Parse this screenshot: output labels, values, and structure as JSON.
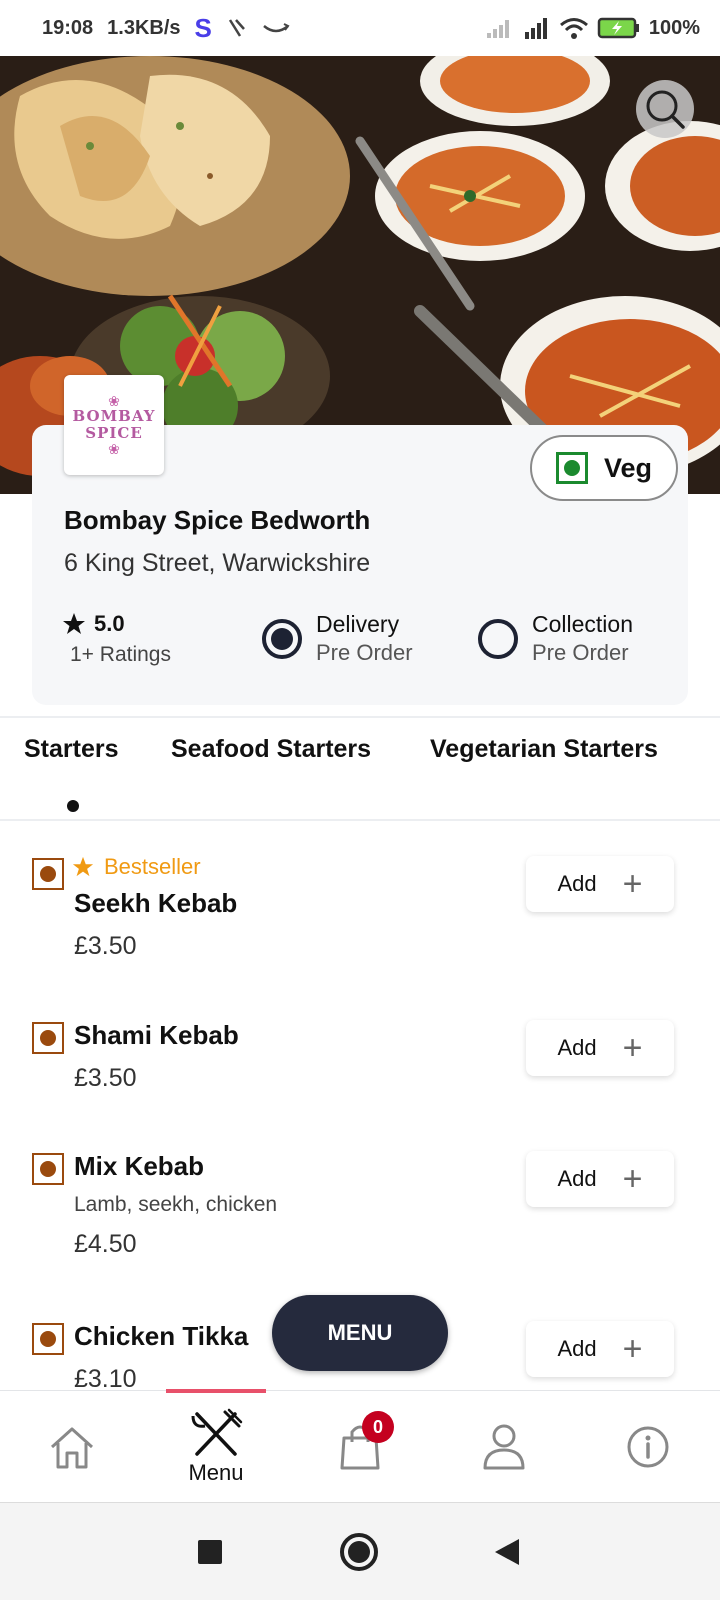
{
  "status_bar": {
    "time": "19:08",
    "net_speed": "1.3KB/s",
    "app_letter": "S",
    "battery": "100%"
  },
  "restaurant": {
    "logo_line1": "BOMBAY",
    "logo_line2": "SPICE",
    "name": "Bombay Spice Bedworth",
    "address": "6 King Street, Warwickshire",
    "rating_value": "5.0",
    "rating_count": "1+ Ratings",
    "veg_label": "Veg"
  },
  "order_options": [
    {
      "title": "Delivery",
      "subtitle": "Pre Order",
      "selected": true
    },
    {
      "title": "Collection",
      "subtitle": "Pre Order",
      "selected": false
    }
  ],
  "tabs": [
    "Starters",
    "Seafood Starters",
    "Vegetarian Starters"
  ],
  "active_tab": "Starters",
  "menu_items": [
    {
      "badge": "Bestseller",
      "name": "Seekh Kebab",
      "price": "£3.50"
    },
    {
      "name": "Shami Kebab",
      "price": "£3.50"
    },
    {
      "name": "Mix Kebab",
      "description": "Lamb, seekh, chicken",
      "price": "£4.50"
    },
    {
      "name": "Chicken Tikka",
      "price": "£3.10"
    }
  ],
  "add_label": "Add",
  "fab_label": "MENU",
  "bottom_nav": {
    "items": [
      "home-icon",
      "menu-icon",
      "cart-icon",
      "profile-icon",
      "info-icon"
    ],
    "menu_label": "Menu",
    "cart_count": "0",
    "active": "menu"
  },
  "colors": {
    "accent_navy": "#252a3d",
    "bestseller": "#f09a13",
    "veg_green": "#1b8a2e",
    "nonveg_brown": "#9a4a0e",
    "badge_red": "#c4001f",
    "active_bar": "#e8506a"
  }
}
